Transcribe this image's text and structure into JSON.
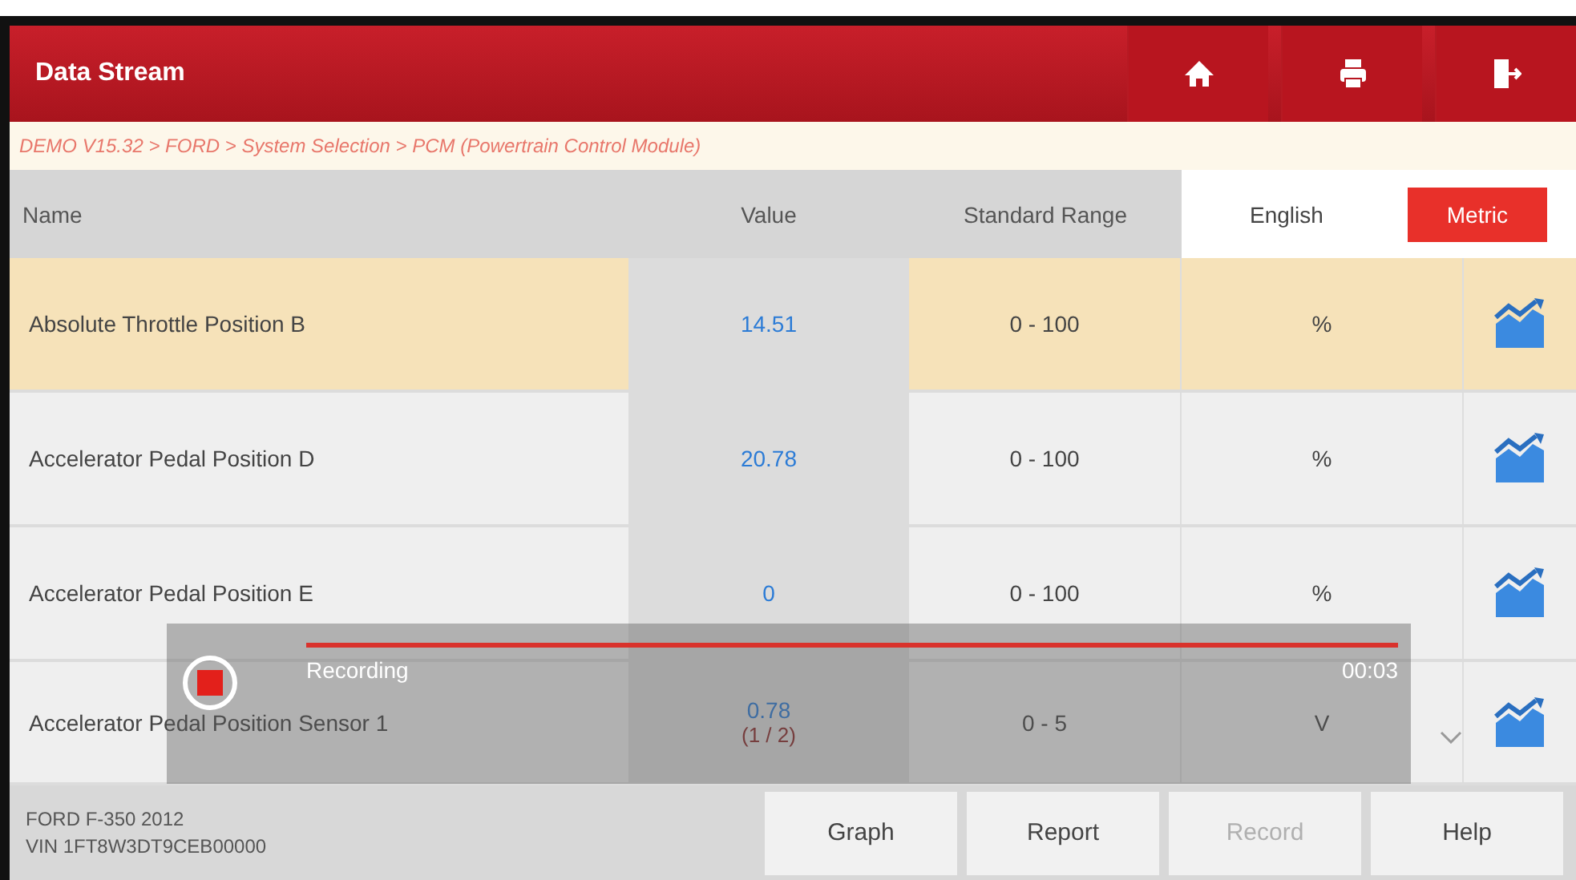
{
  "header": {
    "title": "Data Stream",
    "actions": [
      {
        "kind": "home"
      },
      {
        "kind": "print"
      },
      {
        "kind": "exit"
      }
    ]
  },
  "breadcrumb": "DEMO V15.32 > FORD > System Selection > PCM (Powertrain Control Module)",
  "table": {
    "columns": [
      "Name",
      "Value",
      "Standard Range"
    ],
    "units": [
      {
        "label": "English",
        "selected": false
      },
      {
        "label": "Metric",
        "selected": true
      }
    ],
    "rows": [
      {
        "name": "Absolute Throttle Position B",
        "value": "14.51",
        "range": "0 - 100",
        "unit": "%",
        "selected": true
      },
      {
        "name": "Accelerator Pedal Position D",
        "value": "20.78",
        "range": "0 - 100",
        "unit": "%",
        "selected": false
      },
      {
        "name": "Accelerator Pedal Position E",
        "value": "0",
        "range": "0 - 100",
        "unit": "%",
        "selected": false
      },
      {
        "name": "Accelerator Pedal Position Sensor 1",
        "value": "0.78",
        "range": "0 - 5",
        "unit": "V",
        "selected": false
      }
    ],
    "pager": "(1 / 2)"
  },
  "recording": {
    "label": "Recording",
    "time": "00:03"
  },
  "footer": {
    "vehicle": "FORD F-350 2012",
    "vin": "VIN 1FT8W3DT9CEB00000",
    "buttons": [
      {
        "label": "Graph",
        "disabled": false
      },
      {
        "label": "Report",
        "disabled": false
      },
      {
        "label": "Record",
        "disabled": true
      },
      {
        "label": "Help",
        "disabled": false
      }
    ]
  }
}
